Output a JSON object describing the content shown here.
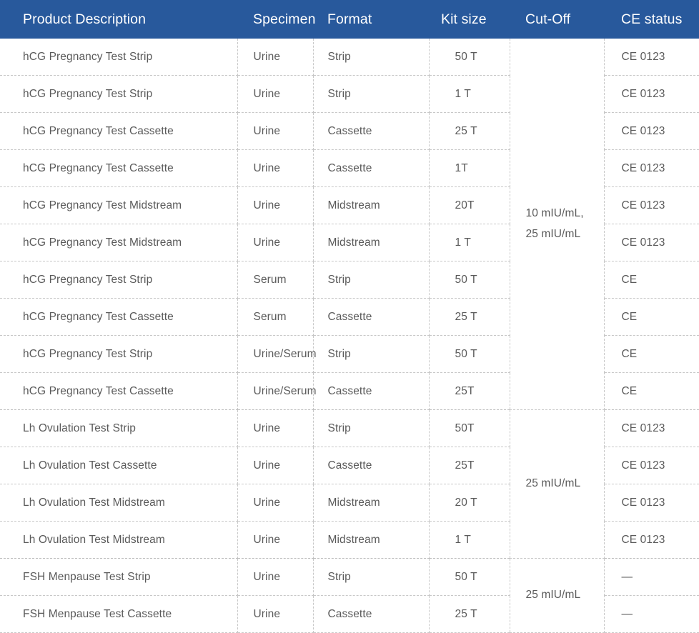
{
  "table": {
    "columns": [
      {
        "key": "product",
        "label": "Product Description"
      },
      {
        "key": "specimen",
        "label": "Specimen"
      },
      {
        "key": "format",
        "label": "Format"
      },
      {
        "key": "kit_size",
        "label": "Kit size"
      },
      {
        "key": "cut_off",
        "label": "Cut-Off"
      },
      {
        "key": "ce_status",
        "label": "CE status"
      }
    ],
    "header": {
      "product": "Product Description",
      "specimen": "Specimen",
      "format": "Format",
      "kit_size": "Kit size",
      "cut_off": "Cut-Off",
      "ce_status": "CE status"
    },
    "colors": {
      "header_background": "#28599c",
      "header_text": "#ffffff",
      "body_text": "#5a5a5a",
      "grid_line": "#c8c8c8",
      "body_background": "#ffffff"
    },
    "cutoff_groups": [
      {
        "value": "10 mIU/mL,\n25 mIU/mL",
        "line1": "10 mIU/mL,",
        "line2": "25 mIU/mL",
        "rowspan": 10
      },
      {
        "value": "25 mIU/mL",
        "line1": "25 mIU/mL",
        "line2": "",
        "rowspan": 4
      },
      {
        "value": "25 mIU/mL",
        "line1": "25 mIU/mL",
        "line2": "",
        "rowspan": 2
      }
    ],
    "rows": [
      {
        "product": "hCG Pregnancy Test Strip",
        "specimen": "Urine",
        "format": "Strip",
        "kit_size": "50 T",
        "ce_status": "CE 0123"
      },
      {
        "product": "hCG Pregnancy Test Strip",
        "specimen": "Urine",
        "format": "Strip",
        "kit_size": "1 T",
        "ce_status": "CE 0123"
      },
      {
        "product": "hCG Pregnancy Test Cassette",
        "specimen": "Urine",
        "format": "Cassette",
        "kit_size": "25 T",
        "ce_status": "CE 0123"
      },
      {
        "product": "hCG Pregnancy Test Cassette",
        "specimen": "Urine",
        "format": "Cassette",
        "kit_size": "1T",
        "ce_status": "CE 0123"
      },
      {
        "product": "hCG Pregnancy Test Midstream",
        "specimen": "Urine",
        "format": "Midstream",
        "kit_size": "20T",
        "ce_status": "CE 0123"
      },
      {
        "product": "hCG Pregnancy Test Midstream",
        "specimen": "Urine",
        "format": "Midstream",
        "kit_size": "1 T",
        "ce_status": "CE 0123"
      },
      {
        "product": "hCG Pregnancy Test Strip",
        "specimen": "Serum",
        "format": "Strip",
        "kit_size": "50 T",
        "ce_status": "CE"
      },
      {
        "product": "hCG Pregnancy Test Cassette",
        "specimen": "Serum",
        "format": "Cassette",
        "kit_size": "25 T",
        "ce_status": "CE"
      },
      {
        "product": "hCG Pregnancy Test Strip",
        "specimen": "Urine/Serum",
        "format": "Strip",
        "kit_size": "50 T",
        "ce_status": "CE"
      },
      {
        "product": "hCG Pregnancy Test Cassette",
        "specimen": "Urine/Serum",
        "format": "Cassette",
        "kit_size": "25T",
        "ce_status": "CE"
      },
      {
        "product": "Lh Ovulation Test Strip",
        "specimen": "Urine",
        "format": "Strip",
        "kit_size": "50T",
        "ce_status": "CE 0123"
      },
      {
        "product": "Lh Ovulation Test Cassette",
        "specimen": "Urine",
        "format": "Cassette",
        "kit_size": "25T",
        "ce_status": "CE 0123"
      },
      {
        "product": "Lh Ovulation Test Midstream",
        "specimen": "Urine",
        "format": "Midstream",
        "kit_size": "20 T",
        "ce_status": "CE 0123"
      },
      {
        "product": "Lh Ovulation Test Midstream",
        "specimen": "Urine",
        "format": "Midstream",
        "kit_size": "1 T",
        "ce_status": "CE 0123"
      },
      {
        "product": "FSH Menpause Test Strip",
        "specimen": "Urine",
        "format": "Strip",
        "kit_size": "50 T",
        "ce_status": "—"
      },
      {
        "product": "FSH Menpause Test Cassette",
        "specimen": "Urine",
        "format": "Cassette",
        "kit_size": "25 T",
        "ce_status": "—"
      }
    ]
  }
}
